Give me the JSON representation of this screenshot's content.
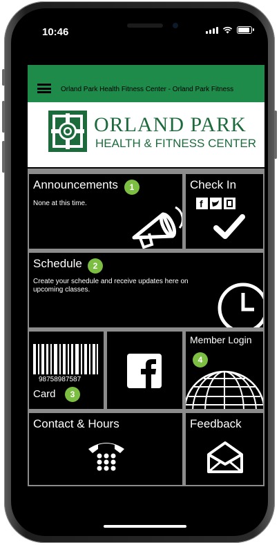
{
  "status_bar": {
    "time": "10:46"
  },
  "header": {
    "title": "Orland Park Health Fitness Center - Orland Park Fitness"
  },
  "logo": {
    "line1": "ORLAND PARK",
    "line2": "HEALTH & FITNESS CENTER"
  },
  "tiles": {
    "announcements": {
      "title": "Announcements",
      "description": "None at this time.",
      "badge": "1",
      "icon": "megaphone-icon"
    },
    "check_in": {
      "title": "Check In",
      "icon": "checkmark-icon"
    },
    "schedule": {
      "title": "Schedule",
      "description": "Create your schedule and receive updates here on upcoming classes.",
      "badge": "2",
      "icon": "clock-icon"
    },
    "card": {
      "title": "Card",
      "barcode_number": "98758987587",
      "badge": "3",
      "icon": "barcode-icon"
    },
    "facebook": {
      "icon": "facebook-icon"
    },
    "member_login": {
      "title": "Member Login",
      "badge": "4",
      "icon": "globe-icon"
    },
    "contact_hours": {
      "title": "Contact & Hours",
      "icon": "telephone-icon"
    },
    "feedback": {
      "title": "Feedback",
      "icon": "envelope-icon"
    }
  },
  "colors": {
    "accent_green": "#1e8b4b",
    "badge_green": "#7cbe42",
    "tile_bg": "#000000",
    "divider": "#8c8c8c"
  }
}
